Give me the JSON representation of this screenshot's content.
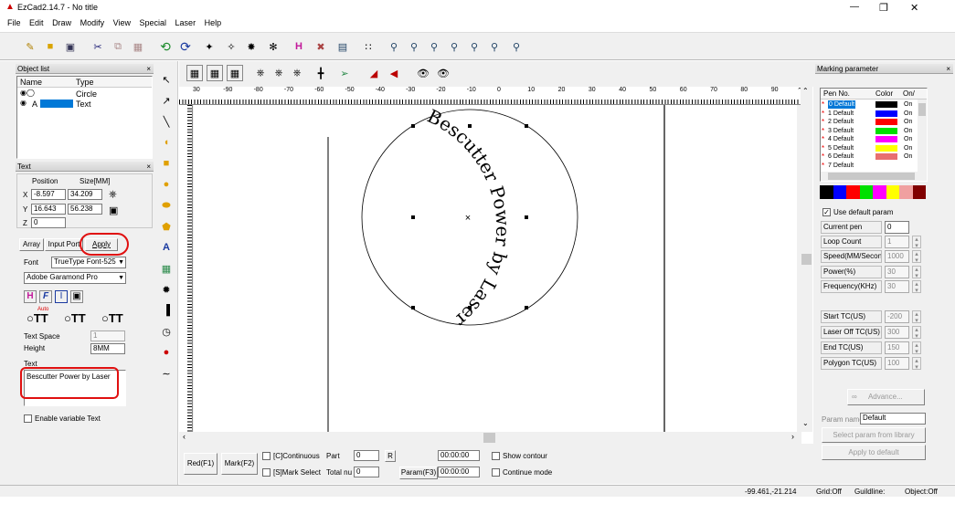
{
  "window": {
    "title": "EzCad2.14.7 - No title",
    "controls": [
      "—",
      "❐",
      "✕"
    ]
  },
  "menu": [
    "File",
    "Edit",
    "Draw",
    "Modify",
    "View",
    "Special",
    "Laser",
    "Help"
  ],
  "object_list": {
    "title": "Object list",
    "col_name": "Name",
    "col_type": "Type",
    "rows": [
      {
        "name": "",
        "type": "Circle"
      },
      {
        "name": "A",
        "type": "Text"
      }
    ]
  },
  "text_panel": {
    "title": "Text",
    "position_label": "Position",
    "size_label": "Size[MM]",
    "x_label": "X",
    "x_pos": "-8.597",
    "x_size": "34.209",
    "y_label": "Y",
    "y_pos": "16.643",
    "y_size": "56.238",
    "z_label": "Z",
    "z_pos": "0",
    "array": "Array",
    "input_port": "Input Port",
    "apply": "Apply",
    "font_label": "Font",
    "font_type": "TrueType Font-525",
    "font_name": "Adobe Garamond Pro",
    "auto_label": "Auto",
    "text_space_label": "Text Space",
    "text_space": "1",
    "height_label": "Height",
    "height": "8MM",
    "text_label": "Text",
    "text_value": "Bescutter Power by Laser",
    "enable_variable": "Enable variable Text"
  },
  "canvas": {
    "ruler_top": [
      "30",
      "-90",
      "-80",
      "-70",
      "-60",
      "-50",
      "-40",
      "-30",
      "-20",
      "-10",
      "0",
      "10",
      "20",
      "30",
      "40",
      "50",
      "60",
      "70",
      "80",
      "90"
    ],
    "curved_text": "Bescutter Power by Laser",
    "center_mark": "×"
  },
  "bottom": {
    "red": "Red(F1)",
    "mark": "Mark(F2)",
    "continuous": "[C]Continuous",
    "part_label": "Part",
    "part_value": "0",
    "r_button": "R",
    "time1": "00:00:00",
    "show_contour": "Show contour",
    "mark_select": "[S]Mark Select",
    "total_label": "Total nu",
    "total_value": "0",
    "param": "Param(F3)",
    "time2": "00:00:00",
    "continue_mode": "Continue mode"
  },
  "status": {
    "coords": "-99.461,-21.214",
    "grid": "Grid:Off",
    "guildline": "Guildline:",
    "object": "Object:Off"
  },
  "marking": {
    "title": "Marking parameter",
    "col_pen": "Pen No.",
    "col_color": "Color",
    "col_on": "On/",
    "pens": [
      {
        "name": "0 Default",
        "color": "#000000",
        "on": "On"
      },
      {
        "name": "1 Default",
        "color": "#0000ff",
        "on": "On"
      },
      {
        "name": "2 Default",
        "color": "#ff0000",
        "on": "On"
      },
      {
        "name": "3 Default",
        "color": "#00e000",
        "on": "On"
      },
      {
        "name": "4 Default",
        "color": "#ff00ff",
        "on": "On"
      },
      {
        "name": "5 Default",
        "color": "#ffff00",
        "on": "On"
      },
      {
        "name": "6 Default",
        "color": "#e87070",
        "on": "On"
      },
      {
        "name": "7 Default",
        "color": "",
        "on": ""
      }
    ],
    "swatches": [
      "#000000",
      "#0000ff",
      "#ff0000",
      "#00e000",
      "#ff00ff",
      "#ffff00",
      "#f0a0a0",
      "#800000"
    ],
    "use_default": "Use default param",
    "current_pen_label": "Current pen",
    "current_pen": "0",
    "loop_label": "Loop Count",
    "loop": "1",
    "speed_label": "Speed(MM/Second)",
    "speed": "1000",
    "power_label": "Power(%)",
    "power": "30",
    "freq_label": "Frequency(KHz)",
    "freq": "30",
    "start_tc_label": "Start TC(US)",
    "start_tc": "-200",
    "laser_off_label": "Laser Off TC(US)",
    "laser_off": "300",
    "end_tc_label": "End TC(US)",
    "end_tc": "150",
    "polygon_label": "Polygon TC(US)",
    "polygon": "100",
    "advance": "Advance...",
    "param_name_label": "Param name",
    "param_name": "Default",
    "select_lib": "Select param from library",
    "apply_default": "Apply to default"
  }
}
